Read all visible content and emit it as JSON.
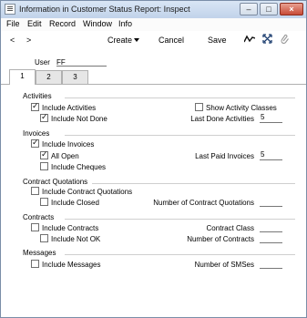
{
  "window": {
    "title": "Information in Customer Status Report: Inspect",
    "minimize": "–",
    "maximize": "□",
    "close": "×"
  },
  "menu": [
    "File",
    "Edit",
    "Record",
    "Window",
    "Info"
  ],
  "toolbar": {
    "prev": "<",
    "next": ">",
    "create": "Create",
    "cancel": "Cancel",
    "save": "Save"
  },
  "header": {
    "user_label": "User",
    "user_value": "FF"
  },
  "tabs": [
    "1",
    "2",
    "3"
  ],
  "activities": {
    "title": "Activities",
    "include_activities": "Include Activities",
    "include_not_done": "Include Not Done",
    "show_activity_classes": "Show Activity Classes",
    "last_done_activities_label": "Last Done Activities",
    "last_done_activities_value": "5"
  },
  "invoices": {
    "title": "Invoices",
    "include_invoices": "Include Invoices",
    "all_open": "All Open",
    "include_cheques": "Include Cheques",
    "last_paid_invoices_label": "Last Paid Invoices",
    "last_paid_invoices_value": "5"
  },
  "contract_quotations": {
    "title": "Contract Quotations",
    "include_contract_quotations": "Include Contract Quotations",
    "include_closed": "Include Closed",
    "number_label": "Number of Contract Quotations",
    "number_value": ""
  },
  "contracts": {
    "title": "Contracts",
    "include_contracts": "Include Contracts",
    "include_not_ok": "Include Not OK",
    "contract_class_label": "Contract Class",
    "contract_class_value": "",
    "number_label": "Number of Contracts",
    "number_value": ""
  },
  "messages": {
    "title": "Messages",
    "include_messages": "Include Messages",
    "number_label": "Number of SMSes",
    "number_value": ""
  }
}
